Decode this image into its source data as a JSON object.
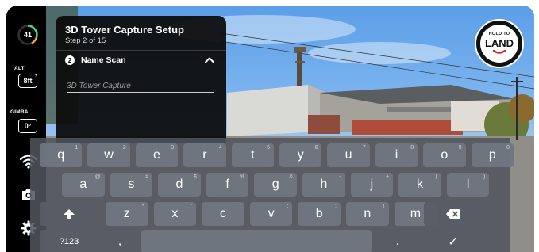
{
  "hud": {
    "battery_value": "41",
    "alt_label": "ALT",
    "alt_value": "8ft",
    "gimbal_label": "GIMBAL",
    "gimbal_value": "0°",
    "colors": {
      "battery_ring": "#3ddc84",
      "battery_warn": "#f5a623",
      "land_accent": "#e02424"
    }
  },
  "setup_panel": {
    "title": "3D Tower Capture Setup",
    "step": "Step 2 of 15",
    "section_number": "2",
    "section_title": "Name Scan",
    "name_placeholder": "3D Tower Capture",
    "name_value": ""
  },
  "land_button": {
    "small_text": "HOLD TO",
    "big_text": "LAND"
  },
  "keyboard": {
    "row1": [
      {
        "k": "q",
        "h": "1"
      },
      {
        "k": "w",
        "h": "2"
      },
      {
        "k": "e",
        "h": "3"
      },
      {
        "k": "r",
        "h": "4"
      },
      {
        "k": "t",
        "h": "5"
      },
      {
        "k": "y",
        "h": "6"
      },
      {
        "k": "u",
        "h": "7"
      },
      {
        "k": "i",
        "h": "8"
      },
      {
        "k": "o",
        "h": "9"
      },
      {
        "k": "p",
        "h": "0"
      }
    ],
    "row2": [
      {
        "k": "a",
        "h": "@"
      },
      {
        "k": "s",
        "h": "#"
      },
      {
        "k": "d",
        "h": "$"
      },
      {
        "k": "f",
        "h": "%"
      },
      {
        "k": "g",
        "h": "&"
      },
      {
        "k": "h",
        "h": "-"
      },
      {
        "k": "j",
        "h": "+"
      },
      {
        "k": "k",
        "h": "("
      },
      {
        "k": "l",
        "h": ")"
      }
    ],
    "row3": [
      {
        "k": "z",
        "h": "*"
      },
      {
        "k": "x",
        "h": "\""
      },
      {
        "k": "c",
        "h": "'"
      },
      {
        "k": "v",
        "h": ":"
      },
      {
        "k": "b",
        "h": ";"
      },
      {
        "k": "n",
        "h": "!"
      },
      {
        "k": "m",
        "h": "?"
      }
    ],
    "symbols_key": "?123",
    "comma_key": ",",
    "period_key": ".",
    "done_key": "✓"
  }
}
